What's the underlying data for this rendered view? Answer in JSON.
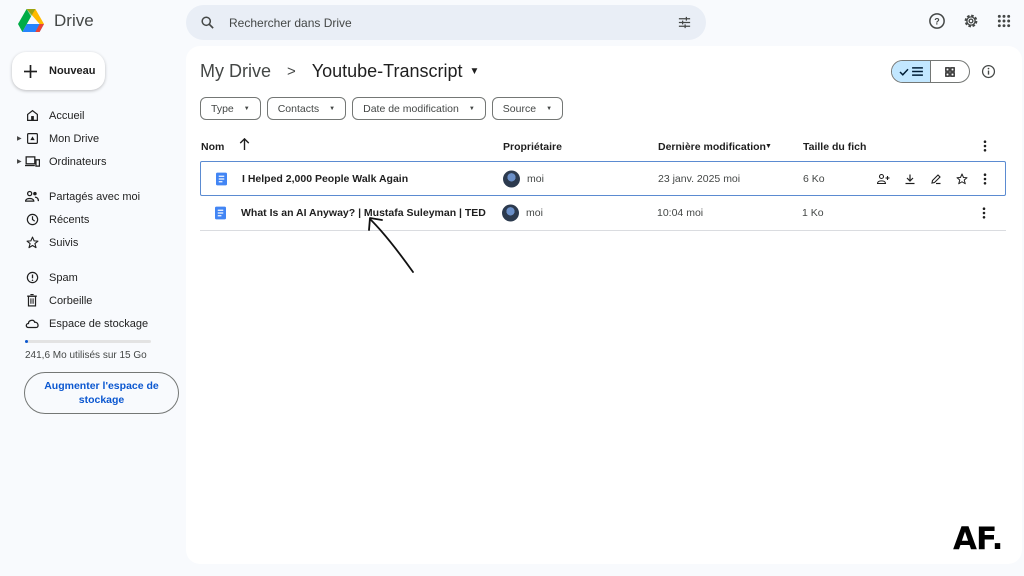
{
  "app": {
    "title": "Drive"
  },
  "search": {
    "placeholder": "Rechercher dans Drive"
  },
  "header_icons": [
    "help-icon",
    "settings-icon",
    "apps-grid-icon"
  ],
  "sidebar": {
    "new_label": "Nouveau",
    "items": [
      {
        "label": "Accueil",
        "icon": "home-icon"
      },
      {
        "label": "Mon Drive",
        "icon": "my-drive-icon",
        "expandable": true
      },
      {
        "label": "Ordinateurs",
        "icon": "computers-icon",
        "expandable": true
      },
      {
        "label": "Partagés avec moi",
        "icon": "shared-icon"
      },
      {
        "label": "Récents",
        "icon": "clock-icon"
      },
      {
        "label": "Suivis",
        "icon": "star-icon"
      },
      {
        "label": "Spam",
        "icon": "spam-icon"
      },
      {
        "label": "Corbeille",
        "icon": "trash-icon"
      },
      {
        "label": "Espace de stockage",
        "icon": "cloud-icon"
      }
    ],
    "storage": {
      "text": "241,6 Mo utilisés sur 15 Go",
      "used_fraction": 0.016
    },
    "upgrade_label": "Augmenter l'espace de stockage"
  },
  "breadcrumb": {
    "root": "My Drive",
    "separator": ">",
    "current": "Youtube-Transcript"
  },
  "filters": [
    "Type",
    "Contacts",
    "Date de modification",
    "Source"
  ],
  "table": {
    "headers": {
      "name": "Nom",
      "owner": "Propriétaire",
      "modified": "Dernière modification",
      "size": "Taille du fich"
    },
    "rows": [
      {
        "name": "I Helped 2,000 People Walk Again",
        "owner": "moi",
        "modified": "23 janv. 2025 moi",
        "size": "6 Ko",
        "selected": true
      },
      {
        "name": "What Is an AI Anyway? | Mustafa Suleyman | TED",
        "owner": "moi",
        "modified": "10:04 moi",
        "size": "1 Ko",
        "selected": false
      }
    ]
  },
  "watermark": "AF.",
  "colors": {
    "accent": "#0b57d0",
    "selected_view": "#c2e7ff",
    "doc_icon": "#4285f4"
  }
}
